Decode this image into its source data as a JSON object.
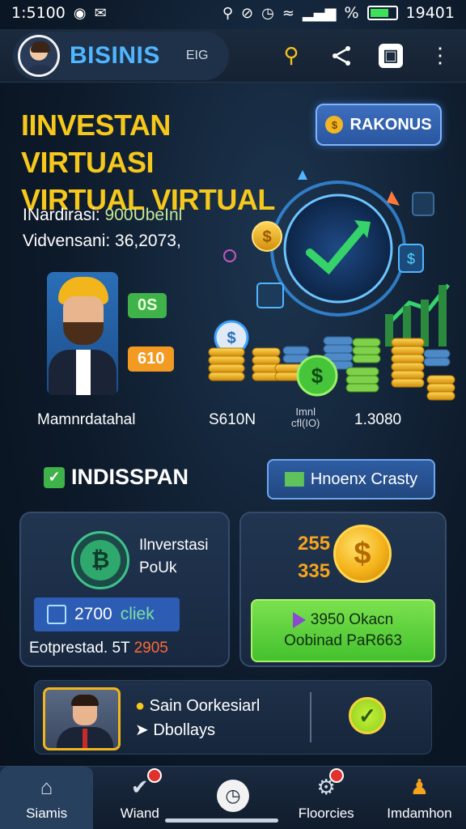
{
  "status_bar": {
    "time": "1:5100",
    "right_text": "19401",
    "percent": "%",
    "battery_level": 0.65
  },
  "header": {
    "brand": "BISINIS",
    "tag": "EIG",
    "icons": [
      "search-icon",
      "share-icon",
      "square-icon",
      "more-vertical-icon"
    ]
  },
  "hero": {
    "title_line1": "IINVESTAN VIRTUASI",
    "title_line2": "VIRTUAL VIRTUAL",
    "rakonus_label": "RAKONUS",
    "stat1_label": "INardirasi:",
    "stat1_value": "900UbeInl",
    "stat2_label": "Vidvensani:",
    "stat2_value": "36,2073,",
    "badge_green": "0S",
    "badge_orange": "610",
    "metric_left": "Mamnrdatahal",
    "metric_mid": "S610N",
    "metric_small_line1": "Imnl",
    "metric_small_line2": "cfl(IO)",
    "metric_right": "1.3080"
  },
  "section": {
    "title": "INDISSPAN",
    "button": "Hnoenx Crasty"
  },
  "card_left": {
    "title_line1": "Ilnverstasi",
    "title_line2": "PoUk",
    "click_value": "2700",
    "click_suffix": "cliek",
    "footer_label": "Eotprestad. 5T",
    "footer_value": "2905"
  },
  "card_right": {
    "num1": "255",
    "num2": "335",
    "button_line1": "3950 Okacn",
    "button_line2": "Oobinad PaR663"
  },
  "promo": {
    "line1": "Sain Oorkesiarl",
    "line2": "Dbollays"
  },
  "nav": [
    {
      "label": "Siamis",
      "icon": "home-icon",
      "badge": false
    },
    {
      "label": "Wiand",
      "icon": "shield-check-icon",
      "badge": true
    },
    {
      "label": "",
      "icon": "clock-icon",
      "badge": false
    },
    {
      "label": "Floorcies",
      "icon": "gear-icon",
      "badge": true
    },
    {
      "label": "Imdamhon",
      "icon": "user-icon",
      "badge": false
    }
  ]
}
